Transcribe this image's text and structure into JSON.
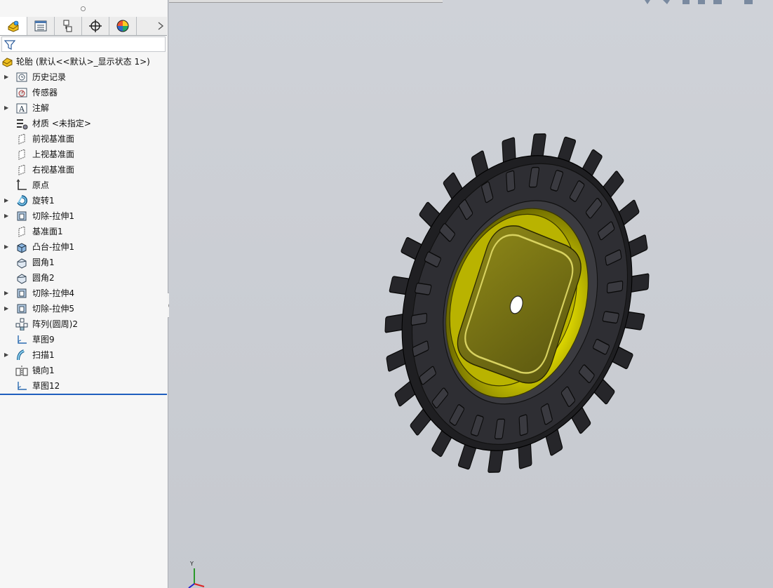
{
  "tabs": [
    {
      "name": "featuremanager",
      "icon": "featuremanager-icon"
    },
    {
      "name": "propertymanager",
      "icon": "propertymanager-icon"
    },
    {
      "name": "configurationmanager",
      "icon": "configurationmanager-icon"
    },
    {
      "name": "dimxpert",
      "icon": "dimxpert-icon"
    },
    {
      "name": "displaymanager",
      "icon": "displaymanager-icon"
    }
  ],
  "tree": {
    "root_label": "轮胎  (默认<<默认>_显示状态 1>)",
    "items": [
      {
        "label": "历史记录",
        "icon": "history-icon",
        "expandable": true
      },
      {
        "label": "传感器",
        "icon": "sensor-icon",
        "expandable": false
      },
      {
        "label": "注解",
        "icon": "annotation-icon",
        "expandable": true
      },
      {
        "label": "材质 <未指定>",
        "icon": "material-icon",
        "expandable": false
      },
      {
        "label": "前视基准面",
        "icon": "plane-icon",
        "expandable": false
      },
      {
        "label": "上视基准面",
        "icon": "plane-icon",
        "expandable": false
      },
      {
        "label": "右视基准面",
        "icon": "plane-icon",
        "expandable": false
      },
      {
        "label": "原点",
        "icon": "origin-icon",
        "expandable": false
      },
      {
        "label": "旋转1",
        "icon": "revolve-icon",
        "expandable": true
      },
      {
        "label": "切除-拉伸1",
        "icon": "cut-extrude-icon",
        "expandable": true
      },
      {
        "label": "基准面1",
        "icon": "plane-icon",
        "expandable": false
      },
      {
        "label": "凸台-拉伸1",
        "icon": "boss-extrude-icon",
        "expandable": true
      },
      {
        "label": "圆角1",
        "icon": "fillet-icon",
        "expandable": false
      },
      {
        "label": "圆角2",
        "icon": "fillet-icon",
        "expandable": false
      },
      {
        "label": "切除-拉伸4",
        "icon": "cut-extrude-icon",
        "expandable": true
      },
      {
        "label": "切除-拉伸5",
        "icon": "cut-extrude-icon",
        "expandable": true
      },
      {
        "label": "阵列(圆周)2",
        "icon": "circular-pattern-icon",
        "expandable": false
      },
      {
        "label": "草图9",
        "icon": "sketch-icon",
        "expandable": false
      },
      {
        "label": "扫描1",
        "icon": "sweep-icon",
        "expandable": true
      },
      {
        "label": "镜向1",
        "icon": "mirror-icon",
        "expandable": false
      },
      {
        "label": "草图12",
        "icon": "sketch-icon",
        "expandable": false
      }
    ]
  },
  "triad": {
    "y_label": "Y"
  },
  "colors": {
    "rim": "#c8c400",
    "tire": "#2a2a2e",
    "rollback": "#1f5fbf"
  }
}
